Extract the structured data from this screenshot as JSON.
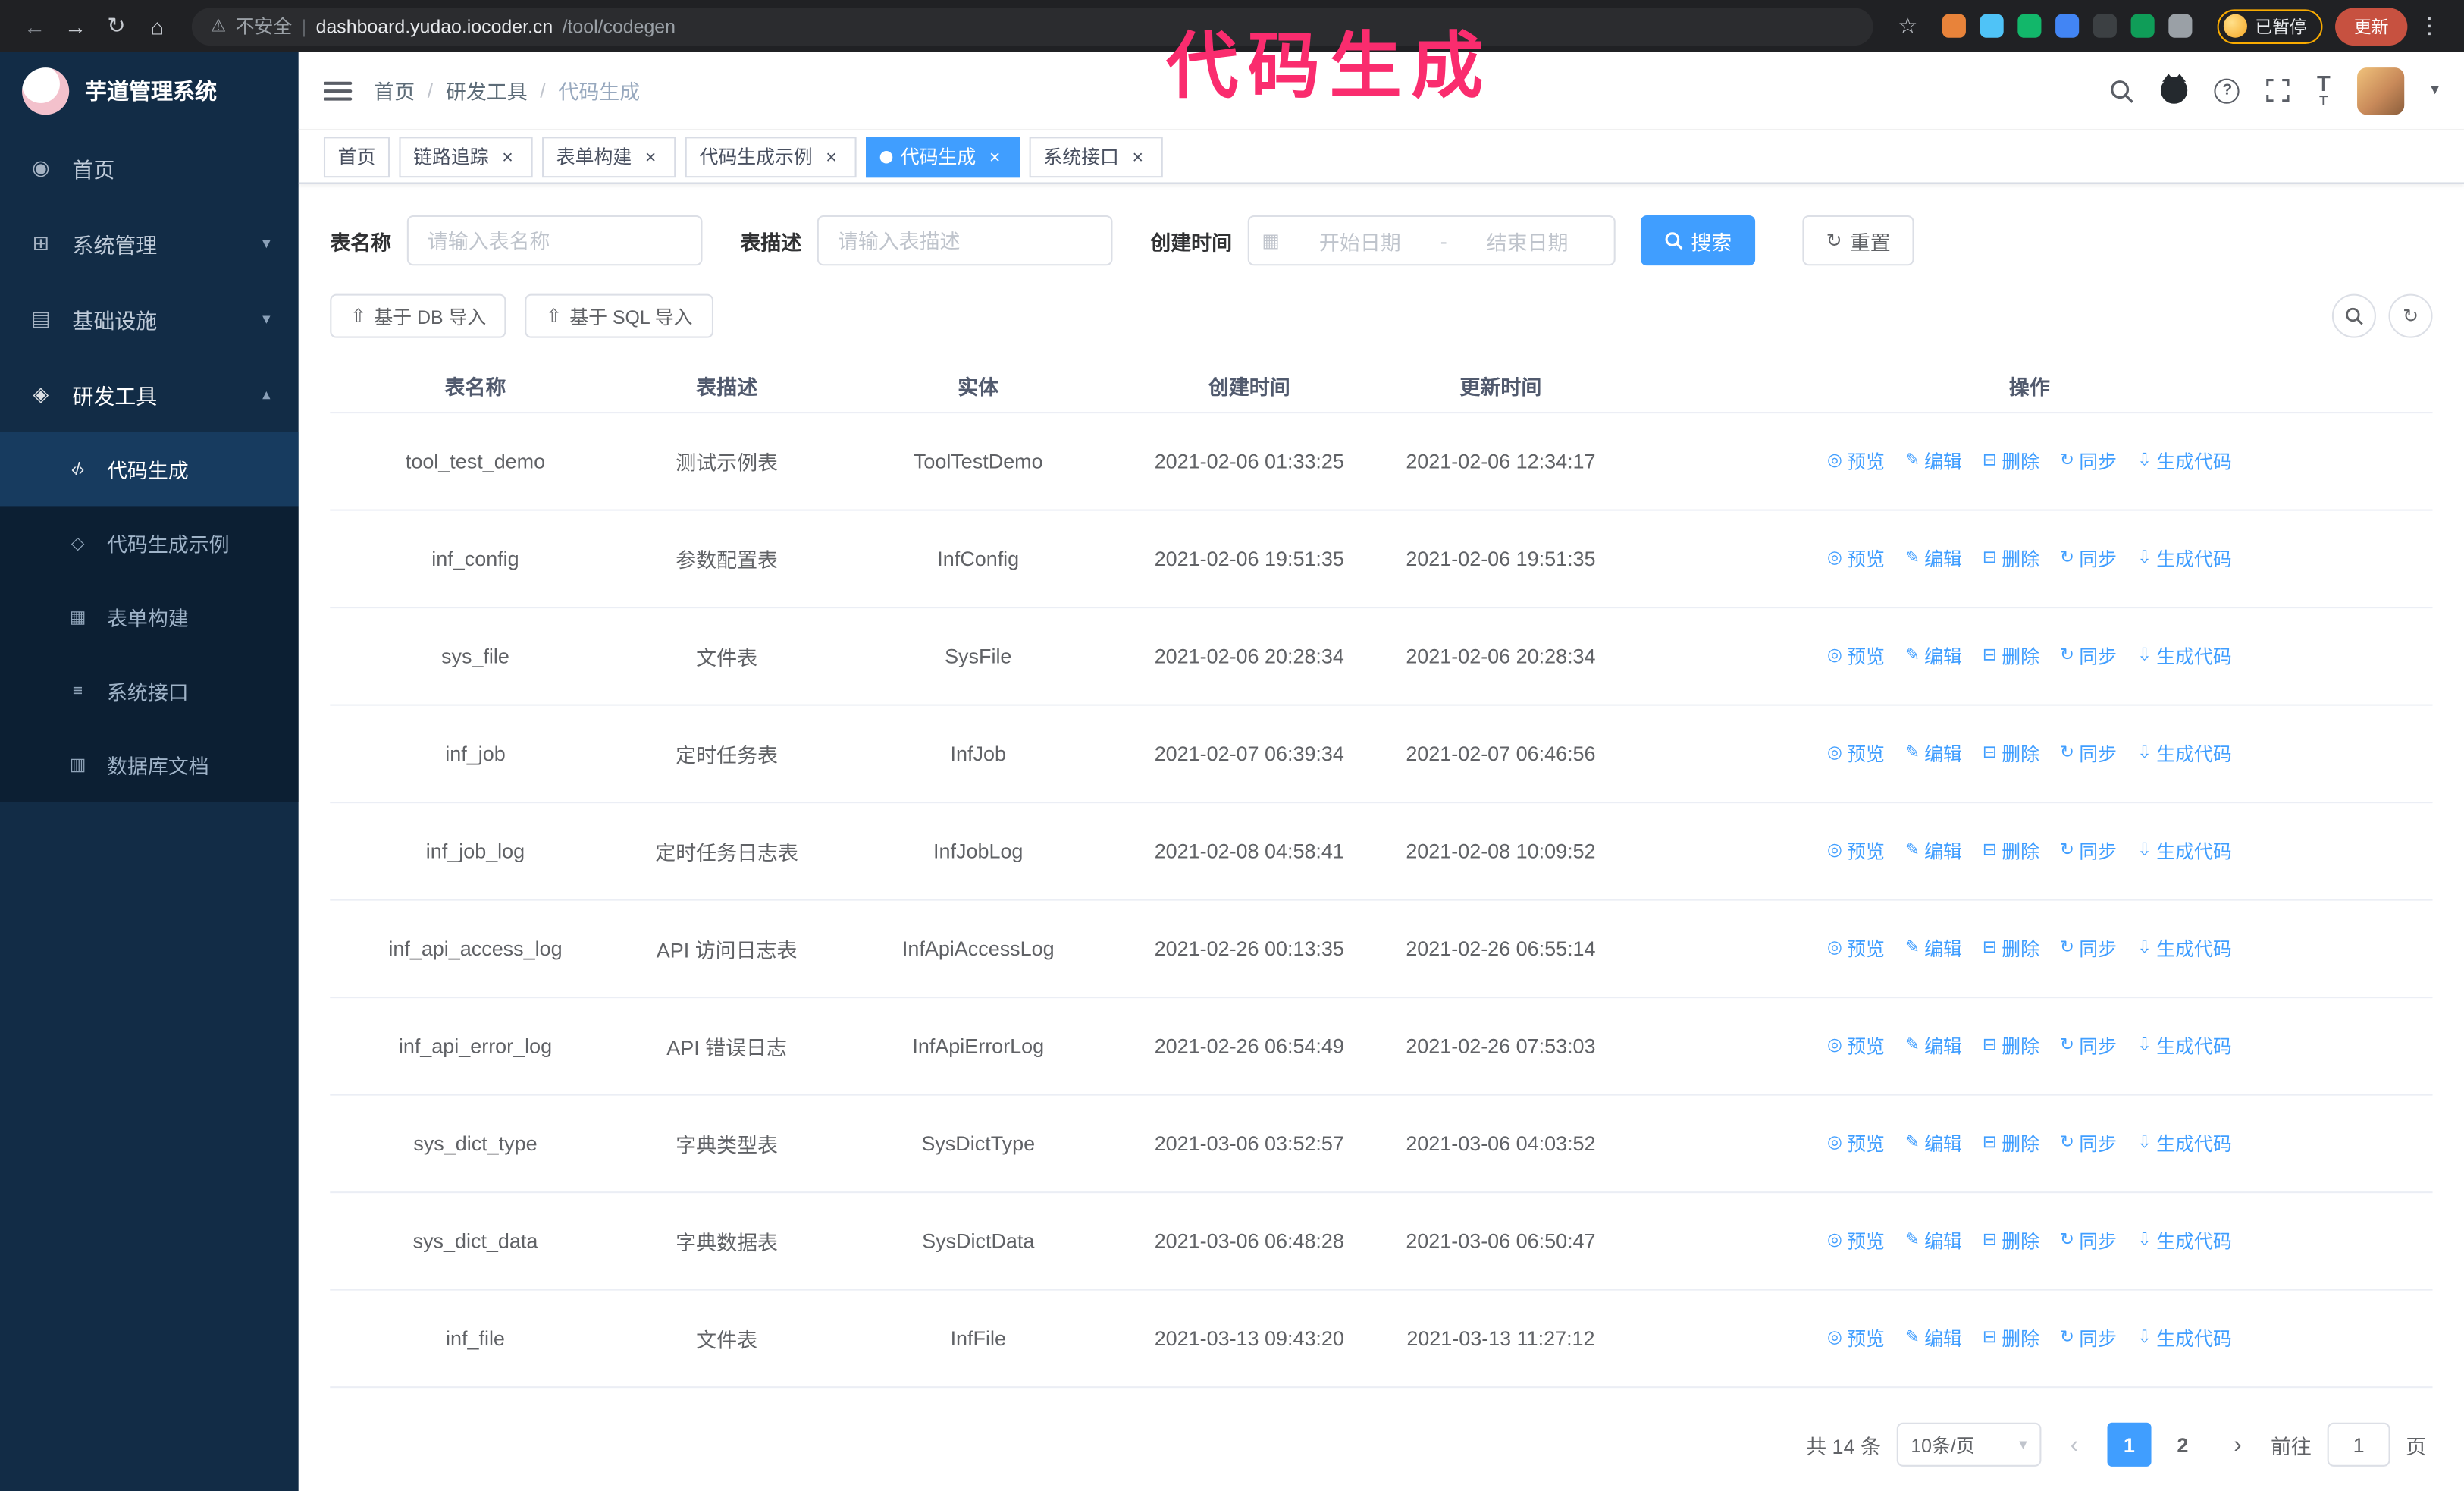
{
  "colors": {
    "accent": "#409EFF",
    "annotation": "#FA2C6E",
    "update_button": "#C75140",
    "sidebar_bg": "#122C46",
    "sidebar_submenu_bg": "#0C1F33"
  },
  "annotation": {
    "text": "代码生成"
  },
  "browser": {
    "security_label": "不安全",
    "url_domain": "dashboard.yudao.iocoder.cn",
    "url_path": "/tool/codegen",
    "paused_badge": "已暂停",
    "update_button": "更新",
    "extensions": [
      {
        "name": "extension-icon-orange",
        "color": "#E8833A"
      },
      {
        "name": "extension-icon-blue-drop",
        "color": "#4FC3F7"
      },
      {
        "name": "extension-icon-green-v",
        "color": "#12B76A"
      },
      {
        "name": "extension-icon-people",
        "color": "#4285F4"
      },
      {
        "name": "extension-icon-dark",
        "color": "#3C4043"
      },
      {
        "name": "extension-icon-leaf",
        "color": "#0F9D58"
      },
      {
        "name": "extension-icon-puzzle",
        "color": "#9AA0A6"
      }
    ]
  },
  "sidebar": {
    "logo_title": "芋道管理系统",
    "items": [
      {
        "label": "首页",
        "icon": "home-icon"
      },
      {
        "label": "系统管理",
        "icon": "gear-icon",
        "chevron": "down"
      },
      {
        "label": "基础设施",
        "icon": "infra-icon",
        "chevron": "down"
      },
      {
        "label": "研发工具",
        "icon": "tools-icon",
        "chevron": "up",
        "expanded": true
      }
    ],
    "subitems": [
      {
        "label": "代码生成",
        "icon": "code-icon",
        "active": true
      },
      {
        "label": "代码生成示例",
        "icon": "example-icon",
        "active": false
      },
      {
        "label": "表单构建",
        "icon": "form-icon",
        "active": false
      },
      {
        "label": "系统接口",
        "icon": "api-icon",
        "active": false
      },
      {
        "label": "数据库文档",
        "icon": "db-doc-icon",
        "active": false
      }
    ]
  },
  "header": {
    "breadcrumb": [
      "首页",
      "研发工具",
      "代码生成"
    ]
  },
  "tabs": [
    {
      "label": "首页",
      "closable": false,
      "active": false
    },
    {
      "label": "链路追踪",
      "closable": true,
      "active": false
    },
    {
      "label": "表单构建",
      "closable": true,
      "active": false
    },
    {
      "label": "代码生成示例",
      "closable": true,
      "active": false
    },
    {
      "label": "代码生成",
      "closable": true,
      "active": true
    },
    {
      "label": "系统接口",
      "closable": true,
      "active": false
    }
  ],
  "filters": {
    "table_name_label": "表名称",
    "table_name_placeholder": "请输入表名称",
    "table_desc_label": "表描述",
    "table_desc_placeholder": "请输入表描述",
    "create_time_label": "创建时间",
    "start_date_placeholder": "开始日期",
    "date_separator": "-",
    "end_date_placeholder": "结束日期",
    "search_button": "搜索",
    "reset_button": "重置"
  },
  "toolbar": {
    "import_db": "基于 DB 导入",
    "import_sql": "基于 SQL 导入"
  },
  "table": {
    "columns": [
      "表名称",
      "表描述",
      "实体",
      "创建时间",
      "更新时间",
      "操作"
    ],
    "actions": [
      {
        "name": "preview",
        "icon": "eye-icon",
        "label": "预览"
      },
      {
        "name": "edit",
        "icon": "edit-icon",
        "label": "编辑"
      },
      {
        "name": "delete",
        "icon": "trash-icon",
        "label": "删除"
      },
      {
        "name": "sync",
        "icon": "sync-icon",
        "label": "同步"
      },
      {
        "name": "generate-code",
        "icon": "download-icon",
        "label": "生成代码"
      }
    ],
    "rows": [
      {
        "name": "tool_test_demo",
        "desc": "测试示例表",
        "entity": "ToolTestDemo",
        "created": "2021-02-06 01:33:25",
        "updated": "2021-02-06 12:34:17"
      },
      {
        "name": "inf_config",
        "desc": "参数配置表",
        "entity": "InfConfig",
        "created": "2021-02-06 19:51:35",
        "updated": "2021-02-06 19:51:35"
      },
      {
        "name": "sys_file",
        "desc": "文件表",
        "entity": "SysFile",
        "created": "2021-02-06 20:28:34",
        "updated": "2021-02-06 20:28:34"
      },
      {
        "name": "inf_job",
        "desc": "定时任务表",
        "entity": "InfJob",
        "created": "2021-02-07 06:39:34",
        "updated": "2021-02-07 06:46:56"
      },
      {
        "name": "inf_job_log",
        "desc": "定时任务日志表",
        "entity": "InfJobLog",
        "created": "2021-02-08 04:58:41",
        "updated": "2021-02-08 10:09:52"
      },
      {
        "name": "inf_api_access_log",
        "desc": "API 访问日志表",
        "entity": "InfApiAccessLog",
        "created": "2021-02-26 00:13:35",
        "updated": "2021-02-26 06:55:14"
      },
      {
        "name": "inf_api_error_log",
        "desc": "API 错误日志",
        "entity": "InfApiErrorLog",
        "created": "2021-02-26 06:54:49",
        "updated": "2021-02-26 07:53:03"
      },
      {
        "name": "sys_dict_type",
        "desc": "字典类型表",
        "entity": "SysDictType",
        "created": "2021-03-06 03:52:57",
        "updated": "2021-03-06 04:03:52"
      },
      {
        "name": "sys_dict_data",
        "desc": "字典数据表",
        "entity": "SysDictData",
        "created": "2021-03-06 06:48:28",
        "updated": "2021-03-06 06:50:47"
      },
      {
        "name": "inf_file",
        "desc": "文件表",
        "entity": "InfFile",
        "created": "2021-03-13 09:43:20",
        "updated": "2021-03-13 11:27:12"
      }
    ]
  },
  "pagination": {
    "total_text": "共 14 条",
    "page_size": "10条/页",
    "prev_icon": "‹",
    "next_icon": "›",
    "pages": [
      "1",
      "2"
    ],
    "current_page": "1",
    "goto_prefix": "前往",
    "goto_value": "1",
    "goto_suffix": "页"
  }
}
